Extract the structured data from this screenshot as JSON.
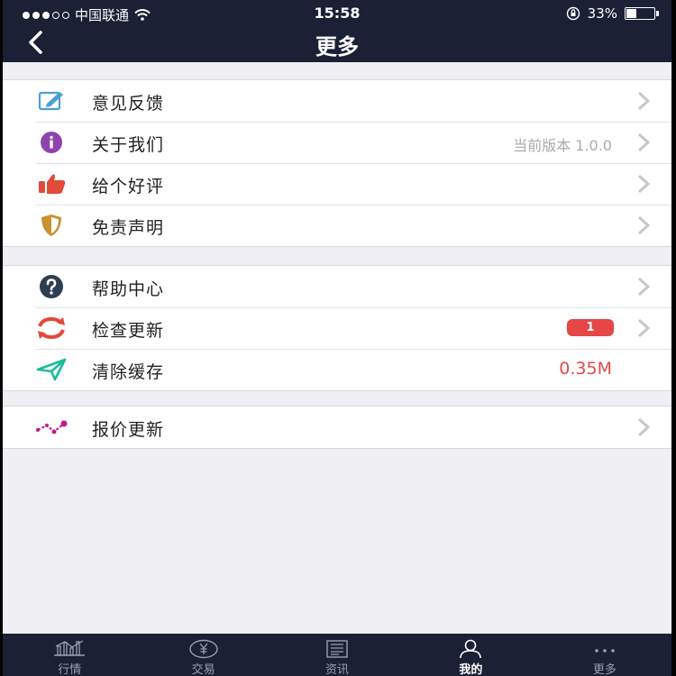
{
  "status_bar": {
    "carrier": "中国联通",
    "time": "15:58",
    "battery_percent": "33%",
    "battery_level": 0.33
  },
  "header": {
    "title": "更多",
    "back_icon": "chevron-left-icon"
  },
  "groups": [
    {
      "items": [
        {
          "label": "意见反馈",
          "icon": "feedback-edit-icon",
          "icon_color": "#4a9fd8"
        },
        {
          "label": "关于我们",
          "icon": "info-icon",
          "icon_color": "#8e44ad",
          "value": "当前版本 1.0.0"
        },
        {
          "label": "给个好评",
          "icon": "thumbs-up-icon",
          "icon_color": "#e04a3a"
        },
        {
          "label": "免责声明",
          "icon": "shield-icon",
          "icon_color": "#c8922f"
        }
      ]
    },
    {
      "items": [
        {
          "label": "帮助中心",
          "icon": "help-icon",
          "icon_color": "#2c3e50"
        },
        {
          "label": "检查更新",
          "icon": "refresh-icon",
          "icon_color": "#e04a3a",
          "badge": "1"
        },
        {
          "label": "清除缓存",
          "icon": "clear-cache-icon",
          "icon_color": "#1abc9c",
          "value": "0.35M",
          "value_color": "#e34a4a"
        }
      ]
    },
    {
      "items": [
        {
          "label": "报价更新",
          "icon": "quote-trend-icon",
          "icon_color": "#c2188e"
        }
      ]
    }
  ],
  "tab_bar": {
    "tabs": [
      {
        "label": "行情",
        "icon": "market-chart-icon"
      },
      {
        "label": "交易",
        "icon": "yuan-coin-icon"
      },
      {
        "label": "资讯",
        "icon": "news-icon"
      },
      {
        "label": "我的",
        "icon": "user-icon",
        "active": true
      },
      {
        "label": "更多",
        "icon": "more-dots-icon"
      }
    ]
  },
  "colors": {
    "header_bg": "#1b2034",
    "page_bg": "#efeff4",
    "chevron": "#c7c7cc",
    "accent_red": "#e34a4a"
  }
}
